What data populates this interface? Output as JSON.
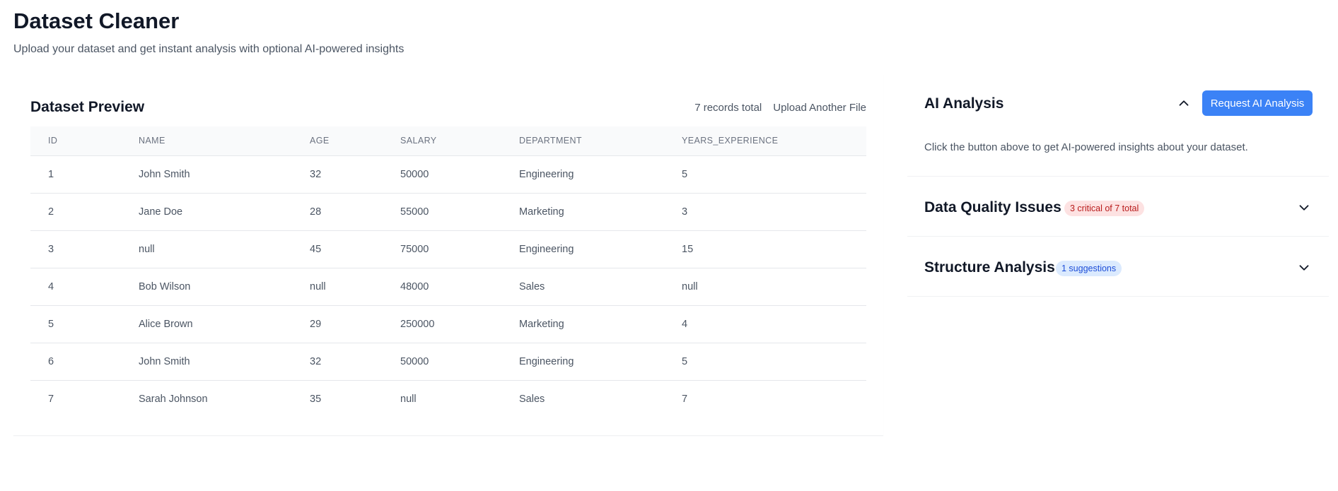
{
  "header": {
    "title": "Dataset Cleaner",
    "subtitle": "Upload your dataset and get instant analysis with optional AI-powered insights"
  },
  "preview": {
    "title": "Dataset Preview",
    "record_count": "7 records total",
    "upload_label": "Upload Another File",
    "columns": [
      "ID",
      "NAME",
      "AGE",
      "SALARY",
      "DEPARTMENT",
      "YEARS_EXPERIENCE"
    ],
    "rows": [
      [
        "1",
        "John Smith",
        "32",
        "50000",
        "Engineering",
        "5"
      ],
      [
        "2",
        "Jane Doe",
        "28",
        "55000",
        "Marketing",
        "3"
      ],
      [
        "3",
        "null",
        "45",
        "75000",
        "Engineering",
        "15"
      ],
      [
        "4",
        "Bob Wilson",
        "null",
        "48000",
        "Sales",
        "null"
      ],
      [
        "5",
        "Alice Brown",
        "29",
        "250000",
        "Marketing",
        "4"
      ],
      [
        "6",
        "John Smith",
        "32",
        "50000",
        "Engineering",
        "5"
      ],
      [
        "7",
        "Sarah Johnson",
        "35",
        "null",
        "Sales",
        "7"
      ]
    ]
  },
  "ai_analysis": {
    "title": "AI Analysis",
    "button_label": "Request AI Analysis",
    "hint": "Click the button above to get AI-powered insights about your dataset.",
    "chevron_icon": "chevron-up-icon"
  },
  "data_quality": {
    "title": "Data Quality Issues",
    "badge": "3 critical of 7 total",
    "chevron_icon": "chevron-down-icon"
  },
  "structure": {
    "title": "Structure Analysis",
    "badge": "1 suggestions",
    "chevron_icon": "chevron-down-icon"
  },
  "colors": {
    "accent": "#3b82f6",
    "critical_bg": "#fde2e2",
    "critical_text": "#b91c1c",
    "info_bg": "#dbeafe",
    "info_text": "#1d4ed8"
  }
}
